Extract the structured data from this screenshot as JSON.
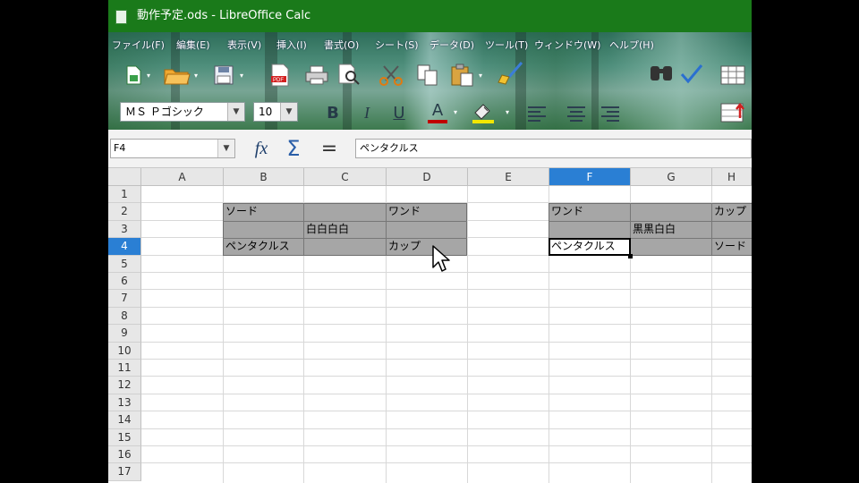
{
  "window": {
    "title": "動作予定.ods - LibreOffice Calc"
  },
  "menu": [
    "ファイル(F)",
    "編集(E)",
    "表示(V)",
    "挿入(I)",
    "書式(O)",
    "シート(S)",
    "データ(D)",
    "ツール(T)",
    "ウィンドウ(W)",
    "ヘルプ(H)"
  ],
  "toolbar": {
    "font_name": "ＭＳ Ｐゴシック",
    "font_size": "10",
    "bold": "B",
    "italic": "I",
    "underline": "U",
    "font_color_glyph": "A",
    "function_wizard": "fx",
    "sum": "Σ",
    "formula": "="
  },
  "formula_bar": {
    "name_box": "F4",
    "content": "ペンタクルス"
  },
  "sheet": {
    "columns": [
      "A",
      "B",
      "C",
      "D",
      "E",
      "F",
      "G",
      "H"
    ],
    "active_column": "F",
    "rows": [
      "1",
      "2",
      "3",
      "4",
      "5",
      "6",
      "7",
      "8",
      "9",
      "10",
      "11",
      "12",
      "13",
      "14",
      "15",
      "16",
      "17"
    ],
    "active_row": "4",
    "active_cell": "F4",
    "cells": {
      "B2": "ソード",
      "D2": "ワンド",
      "F2": "ワンド",
      "H2": "カップ",
      "C3": "白白白白",
      "G3": "黒黒白白",
      "B4": "ペンタクルス",
      "D4": "カップ",
      "F4": "ペンタクルス",
      "H4": "ソード"
    },
    "shaded_fill_color": "#a6a6a6",
    "selection_color": "#2a7fd4"
  }
}
